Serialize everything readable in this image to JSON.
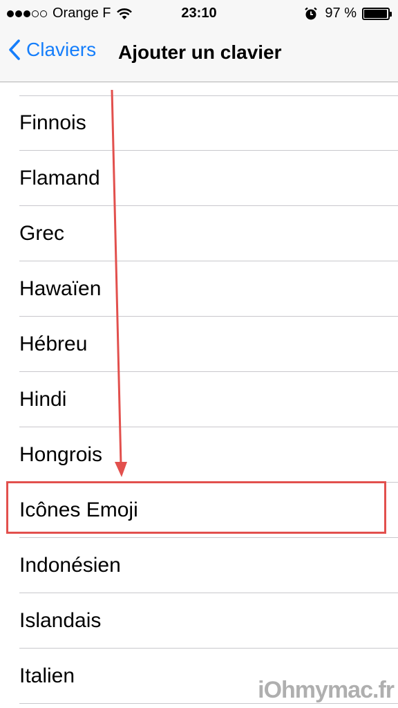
{
  "status_bar": {
    "carrier": "Orange F",
    "time": "23:10",
    "battery": "97 %",
    "battery_level": 0.97,
    "signal_bars_filled": 3,
    "signal_bars_total": 5
  },
  "nav": {
    "back_label": "Claviers",
    "title": "Ajouter un clavier"
  },
  "languages": [
    "Finnois",
    "Flamand",
    "Grec",
    "Hawaïen",
    "Hébreu",
    "Hindi",
    "Hongrois",
    "Icônes Emoji",
    "Indonésien",
    "Islandais",
    "Italien"
  ],
  "highlighted_item": "Icônes Emoji",
  "annotation_color": "#e2504d",
  "watermark": "iOhmymac.fr"
}
